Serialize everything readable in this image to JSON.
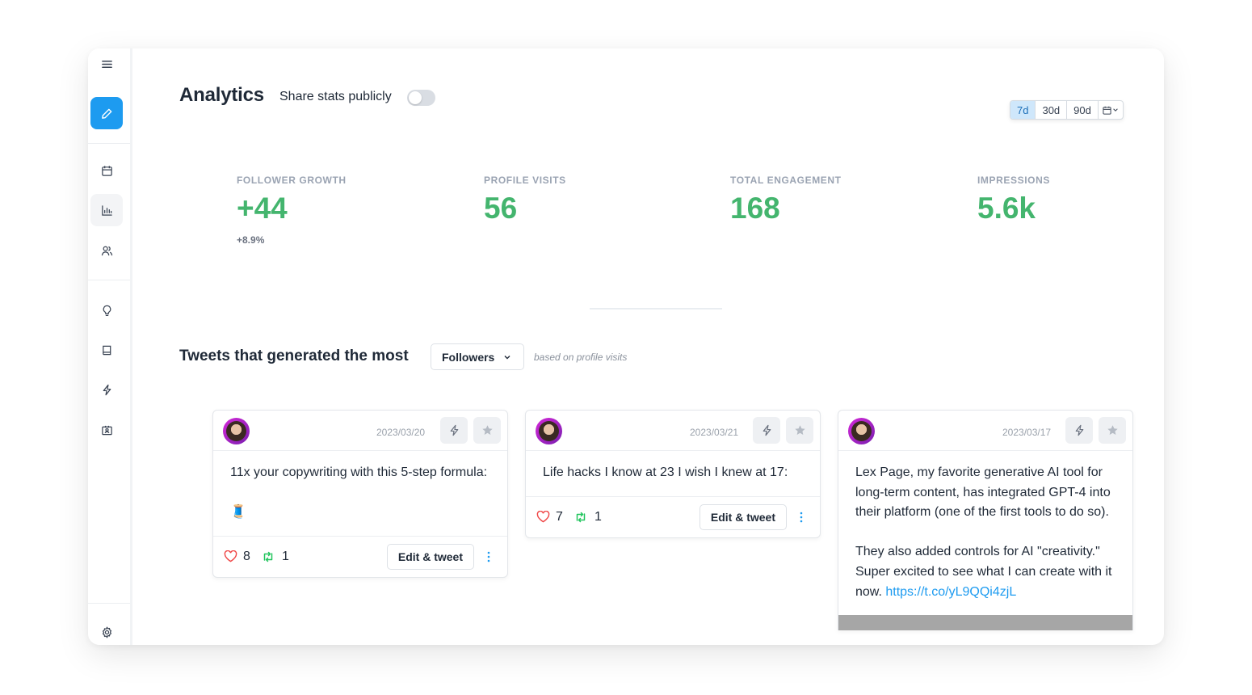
{
  "header": {
    "title": "Analytics",
    "share_label": "Share stats publicly",
    "share_enabled": false
  },
  "range": {
    "options": [
      "7d",
      "30d",
      "90d"
    ],
    "selected": "7d"
  },
  "stats": [
    {
      "label": "FOLLOWER GROWTH",
      "value": "+44",
      "sub": "+8.9%"
    },
    {
      "label": "PROFILE VISITS",
      "value": "56"
    },
    {
      "label": "TOTAL ENGAGEMENT",
      "value": "168"
    },
    {
      "label": "IMPRESSIONS",
      "value": "5.6k"
    }
  ],
  "tweets_section": {
    "title": "Tweets that generated the most",
    "metric": "Followers",
    "note": "based on profile visits"
  },
  "tweets": [
    {
      "date": "2023/03/20",
      "text": "11x your copywriting with this 5-step formula:\n\n🧵",
      "likes": "8",
      "retweets": "1",
      "edit_label": "Edit & tweet"
    },
    {
      "date": "2023/03/21",
      "text": "Life hacks I know at 23 I wish I knew at 17:",
      "likes": "7",
      "retweets": "1",
      "edit_label": "Edit & tweet"
    },
    {
      "date": "2023/03/17",
      "text": "Lex Page, my favorite generative AI tool for long-term content, has integrated GPT-4 into their platform (one of the first tools to do so).\n\nThey also added controls for AI \"creativity.\" Super excited to see what I can create with it now. ",
      "link": "https://t.co/yL9QQi4zjL"
    }
  ],
  "colors": {
    "accent": "#1d9bf0",
    "stat_green": "#44b56e",
    "like_red": "#ef4444",
    "retweet_green": "#22c55e"
  },
  "icons": {
    "sidebar": [
      "menu-icon",
      "pencil-icon",
      "calendar-icon",
      "bar-chart-icon",
      "users-icon",
      "lightbulb-icon",
      "book-icon",
      "lightning-icon",
      "id-card-icon",
      "gear-icon"
    ]
  }
}
